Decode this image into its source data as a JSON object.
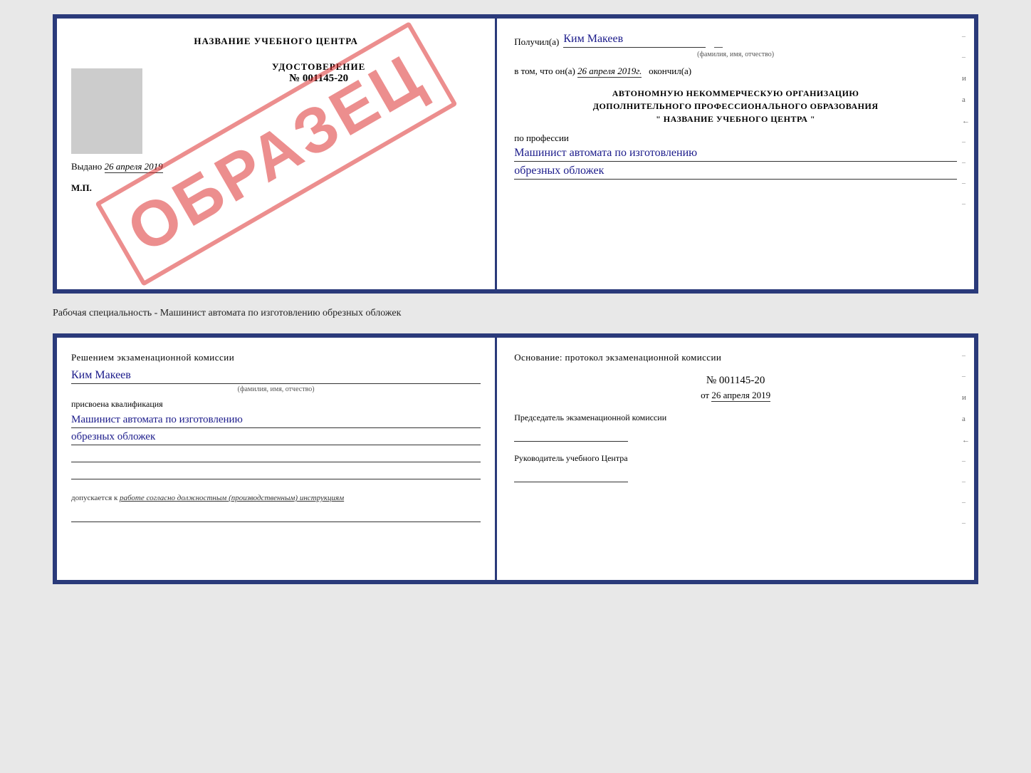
{
  "top_doc": {
    "left": {
      "title": "НАЗВАНИЕ УЧЕБНОГО ЦЕНТРА",
      "stamp": "ОБРАЗЕЦ",
      "udostoverenie_label": "УДОСТОВЕРЕНИЕ",
      "number": "№ 001145-20",
      "vydano_label": "Выдано",
      "vydano_date": "26 апреля 2019",
      "mp_label": "М.П."
    },
    "right": {
      "received_label": "Получил(а)",
      "received_name": "Ким Макеев",
      "fio_subtitle": "(фамилия, имя, отчество)",
      "vtom_label": "в том, что он(а)",
      "vtom_date": "26 апреля 2019г.",
      "okonchil_label": "окончил(а)",
      "org_line1": "АВТОНОМНУЮ НЕКОММЕРЧЕСКУЮ ОРГАНИЗАЦИЮ",
      "org_line2": "ДОПОЛНИТЕЛЬНОГО ПРОФЕССИОНАЛЬНОГО ОБРАЗОВАНИЯ",
      "org_line3": "\" НАЗВАНИЕ УЧЕБНОГО ЦЕНТРА \"",
      "profession_label": "по профессии",
      "profession_line1": "Машинист автомата по изготовлению",
      "profession_line2": "обрезных обложек"
    }
  },
  "separator": {
    "text": "Рабочая специальность - Машинист автомата по изготовлению обрезных обложек"
  },
  "bottom_doc": {
    "left": {
      "resheniem_label": "Решением экзаменационной комиссии",
      "fio": "Ким Макеев",
      "fio_subtitle": "(фамилия, имя, отчество)",
      "prisvoena_label": "присвоена квалификация",
      "qualification_line1": "Машинист автомата по изготовлению",
      "qualification_line2": "обрезных обложек",
      "dopuskaetsya_label": "допускается к",
      "dopuskaetsya_val": "работе согласно должностным (производственным) инструкциям"
    },
    "right": {
      "osnov_label": "Основание: протокол экзаменационной комиссии",
      "protocol_num": "№ 001145-20",
      "ot_label": "от",
      "protocol_date": "26 апреля 2019",
      "chairman_label": "Председатель экзаменационной комиссии",
      "rukovoditel_label": "Руководитель учебного Центра"
    }
  }
}
